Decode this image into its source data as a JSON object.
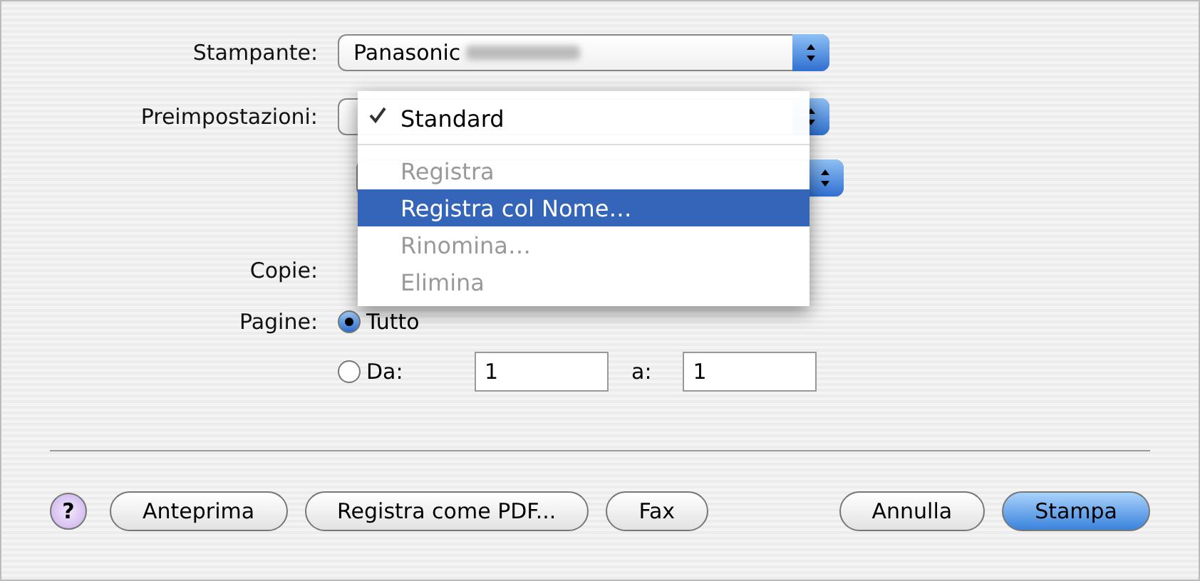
{
  "printer": {
    "label": "Stampante:",
    "value": "Panasonic"
  },
  "presets": {
    "label": "Preimpostazioni:",
    "menu": [
      {
        "label": "Standard",
        "checked": true,
        "disabled": false,
        "selected": false,
        "separator_after": true
      },
      {
        "label": "Registra",
        "checked": false,
        "disabled": true,
        "selected": false,
        "separator_after": false
      },
      {
        "label": "Registra col Nome…",
        "checked": false,
        "disabled": false,
        "selected": true,
        "separator_after": false
      },
      {
        "label": "Rinomina…",
        "checked": false,
        "disabled": true,
        "selected": false,
        "separator_after": false
      },
      {
        "label": "Elimina",
        "checked": false,
        "disabled": true,
        "selected": false,
        "separator_after": false
      }
    ]
  },
  "copies": {
    "label": "Copie:"
  },
  "pages": {
    "label": "Pagine:",
    "radios": [
      {
        "label": "Tutto",
        "selected": true
      },
      {
        "label": "Da:",
        "selected": false
      }
    ],
    "from": "1",
    "to_label": "a:",
    "to": "1"
  },
  "help": "?",
  "buttons": [
    {
      "label": "Anteprima",
      "default": false
    },
    {
      "label": "Registra come PDF...",
      "default": false
    },
    {
      "label": "Fax",
      "default": false
    },
    {
      "label": "Annulla",
      "default": false
    },
    {
      "label": "Stampa",
      "default": true
    }
  ]
}
